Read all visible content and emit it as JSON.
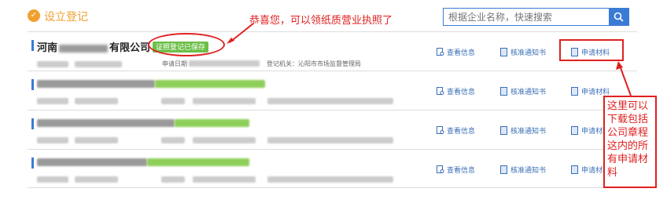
{
  "header": {
    "logo_icon": "flag-icon",
    "title": "设立登记",
    "search": {
      "placeholder": "根据企业名称，快速搜索",
      "icon": "search-icon"
    },
    "accent_color": "#3a7bd5",
    "title_color": "#f0a030"
  },
  "annotations": {
    "top_note": "恭喜您，可以领纸质营业执照了",
    "callout": "这里可以下载包括公司章程这内的所有申请材料",
    "color": "#e02020"
  },
  "rows": [
    {
      "company_prefix": "河南",
      "company_suffix": "有限公司",
      "status_badge": "证照登记已保存",
      "date_label": "申请日期",
      "authority": "登记机关：沁阳市市场监督管理局",
      "actions": {
        "view": "查看信息",
        "notice": "核准通知书",
        "materials": "申请材料"
      }
    },
    {
      "actions": {
        "view": "查看信息",
        "notice": "核准通知书",
        "materials": "申请材料"
      }
    },
    {
      "actions": {
        "view": "查看信息",
        "notice": "核准通知书",
        "materials": "申请材料"
      }
    },
    {
      "actions": {
        "view": "查看信息",
        "notice": "核准通知书",
        "materials": "申请材料"
      }
    }
  ]
}
